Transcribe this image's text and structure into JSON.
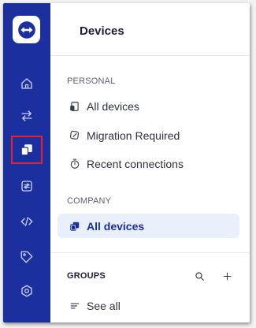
{
  "rail": {
    "items": [
      {
        "icon": "home-icon"
      },
      {
        "icon": "transfer-arrows-icon"
      },
      {
        "icon": "devices-icon",
        "selected": true
      },
      {
        "icon": "remote-session-icon"
      },
      {
        "icon": "code-icon"
      },
      {
        "icon": "tag-icon"
      },
      {
        "icon": "settings-hexagon-icon"
      }
    ]
  },
  "header": {
    "title": "Devices"
  },
  "personal": {
    "label": "PERSONAL",
    "items": [
      {
        "label": "All devices",
        "icon": "device-list-icon"
      },
      {
        "label": "Migration Required",
        "icon": "migration-icon"
      },
      {
        "label": "Recent connections",
        "icon": "stopwatch-icon"
      }
    ]
  },
  "company": {
    "label": "COMPANY",
    "items": [
      {
        "label": "All devices",
        "icon": "devices-icon",
        "active": true
      }
    ]
  },
  "groups": {
    "label": "GROUPS",
    "search_icon": "search-icon",
    "add_icon": "plus-icon",
    "items": [
      {
        "label": "See all",
        "icon": "list-lines-icon"
      }
    ]
  },
  "colors": {
    "rail": "#1b2f9e",
    "active_bg": "#eaf0fb",
    "highlight_outline": "#e5222a"
  }
}
